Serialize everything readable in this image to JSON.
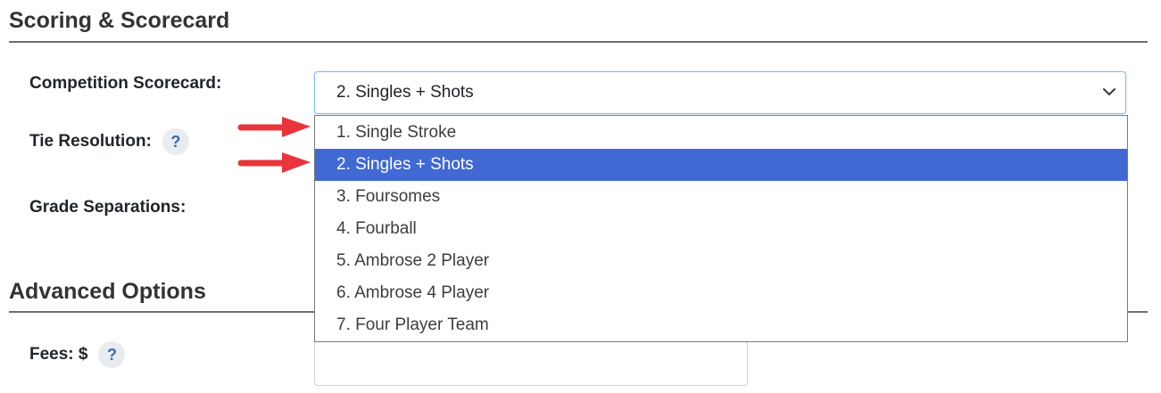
{
  "sections": {
    "scoring_title": "Scoring & Scorecard",
    "advanced_title": "Advanced Options"
  },
  "fields": {
    "competition_scorecard_label": "Competition Scorecard:",
    "tie_resolution_label": "Tie Resolution:",
    "grade_separations_label": "Grade Separations:",
    "fees_label": "Fees: $",
    "help_glyph": "?"
  },
  "scorecard_select": {
    "selected_value": "2. Singles + Shots",
    "options": [
      "1. Single Stroke",
      "2. Singles + Shots",
      "3. Foursomes",
      "4. Fourball",
      "5. Ambrose 2 Player",
      "6. Ambrose 4 Player",
      "7. Four Player Team"
    ],
    "highlighted_index": 1
  },
  "fees_input": {
    "value": ""
  },
  "icons": {
    "help": "question-mark-icon",
    "select_caret": "chevron-down-icon",
    "annotation": "red-arrow-icon"
  },
  "colors": {
    "highlight": "#4169d3",
    "arrow": "#e8353b",
    "help_text": "#3e6aa6"
  }
}
